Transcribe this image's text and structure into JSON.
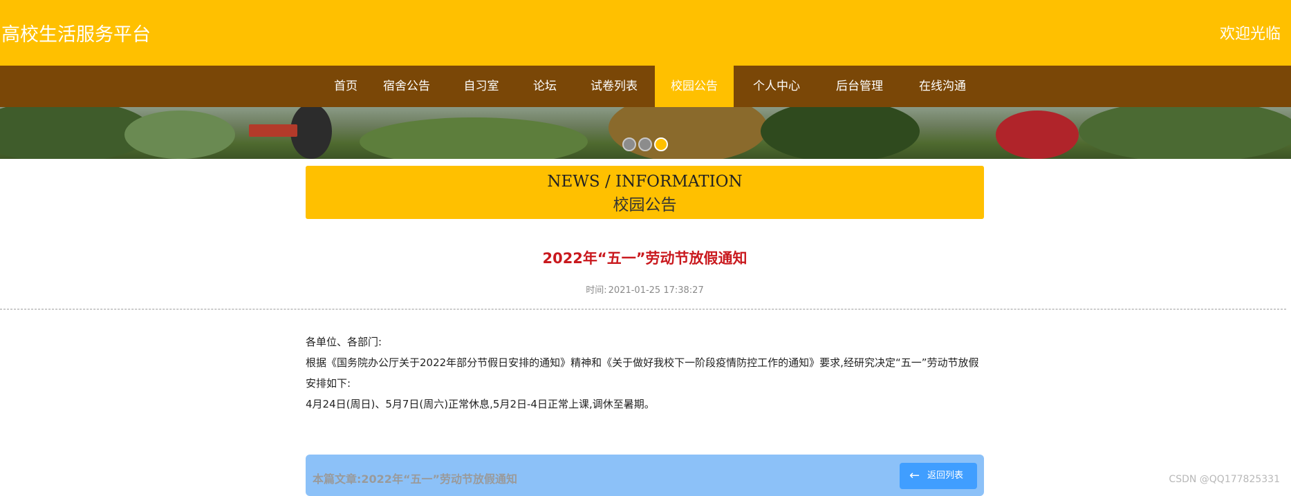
{
  "header": {
    "brand": "高校生活服务平台",
    "welcome": "欢迎光临"
  },
  "nav": {
    "items": [
      {
        "label": "首页"
      },
      {
        "label": "宿舍公告"
      },
      {
        "label": "自习室"
      },
      {
        "label": "论坛"
      },
      {
        "label": "试卷列表"
      },
      {
        "label": "校园公告"
      },
      {
        "label": "个人中心"
      },
      {
        "label": "后台管理"
      },
      {
        "label": "在线沟通"
      }
    ],
    "active": "校园公告"
  },
  "banner": {
    "slides": 3,
    "active_slide": 3
  },
  "section": {
    "en": "NEWS / INFORMATION",
    "cn": "校园公告"
  },
  "article": {
    "title": "2022年“五一”劳动节放假通知",
    "time_label": "时间:",
    "time_value": "2021-01-25 17:38:27",
    "paragraphs": [
      "各单位、各部门:",
      "根据《国务院办公厅关于2022年部分节假日安排的通知》精神和《关于做好我校下一阶段疫情防控工作的通知》要求,经研究决定“五一”劳动节放假安排如下:",
      "4月24日(周日)、5月7日(周六)正常休息,5月2日-4日正常上课,调休至暑期。"
    ]
  },
  "footer": {
    "current_label": "本篇文章:",
    "current_title": "2022年“五一”劳动节放假通知",
    "back_label": "返回列表",
    "back_icon": "arrow-left-icon"
  },
  "watermark": "CSDN @QQ177825331",
  "colors": {
    "accent": "#ffc000",
    "nav_bg": "#7a4707",
    "title_red": "#c9191e",
    "button_blue": "#409eff",
    "footer_blue": "#8cc1f8"
  }
}
